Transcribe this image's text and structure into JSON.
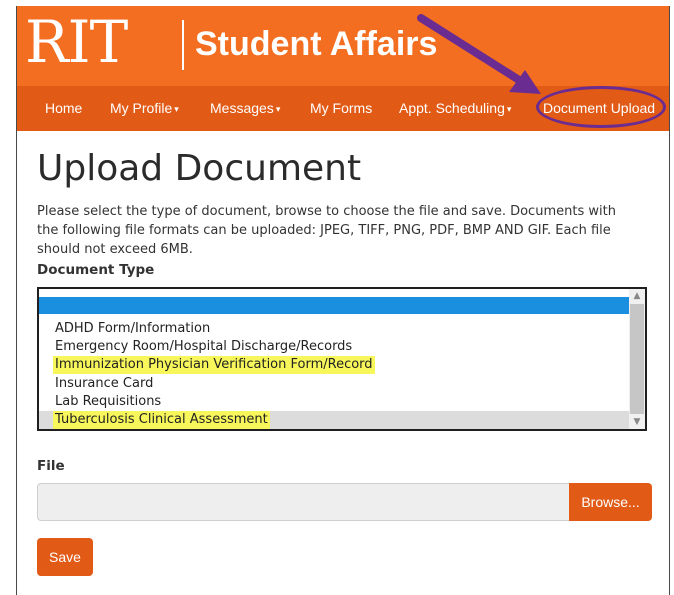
{
  "header": {
    "logo_text": "RIT",
    "site_title": "Student Affairs"
  },
  "nav": {
    "items": [
      {
        "label": "Home"
      },
      {
        "label": "My Profile",
        "dropdown": true
      },
      {
        "label": "Messages",
        "dropdown": true
      },
      {
        "label": "My Forms"
      },
      {
        "label": "Appt. Scheduling",
        "dropdown": true
      },
      {
        "label": "Document Upload",
        "annotated": true
      }
    ],
    "caret_glyph": "▾"
  },
  "annotation": {
    "arrow_color": "#6a2c91",
    "ellipse_color": "#6a2c91",
    "highlight_color": "#f7f75b"
  },
  "page": {
    "title": "Upload Document",
    "instructions": "Please select the type of document, browse to choose the file and save. Documents with the following file formats can be uploaded: JPEG, TIFF, PNG, PDF, BMP AND GIF. Each file should not exceed 6MB.",
    "document_type_label": "Document Type",
    "document_type_selected": "",
    "document_type_options": [
      {
        "label": "ADHD Form/Information",
        "highlighted": false
      },
      {
        "label": "Emergency Room/Hospital Discharge/Records",
        "highlighted": false
      },
      {
        "label": "Immunization Physician Verification Form/Record",
        "highlighted": true
      },
      {
        "label": "Insurance Card",
        "highlighted": false
      },
      {
        "label": "Lab Requisitions",
        "highlighted": false
      },
      {
        "label": "Tuberculosis Clinical Assessment",
        "highlighted": true
      }
    ],
    "file_label": "File",
    "file_value": "",
    "browse_label": "Browse...",
    "save_label": "Save"
  },
  "colors": {
    "brand_orange": "#f36e21",
    "nav_orange": "#e15a16",
    "selection_blue": "#1a8fe0"
  }
}
